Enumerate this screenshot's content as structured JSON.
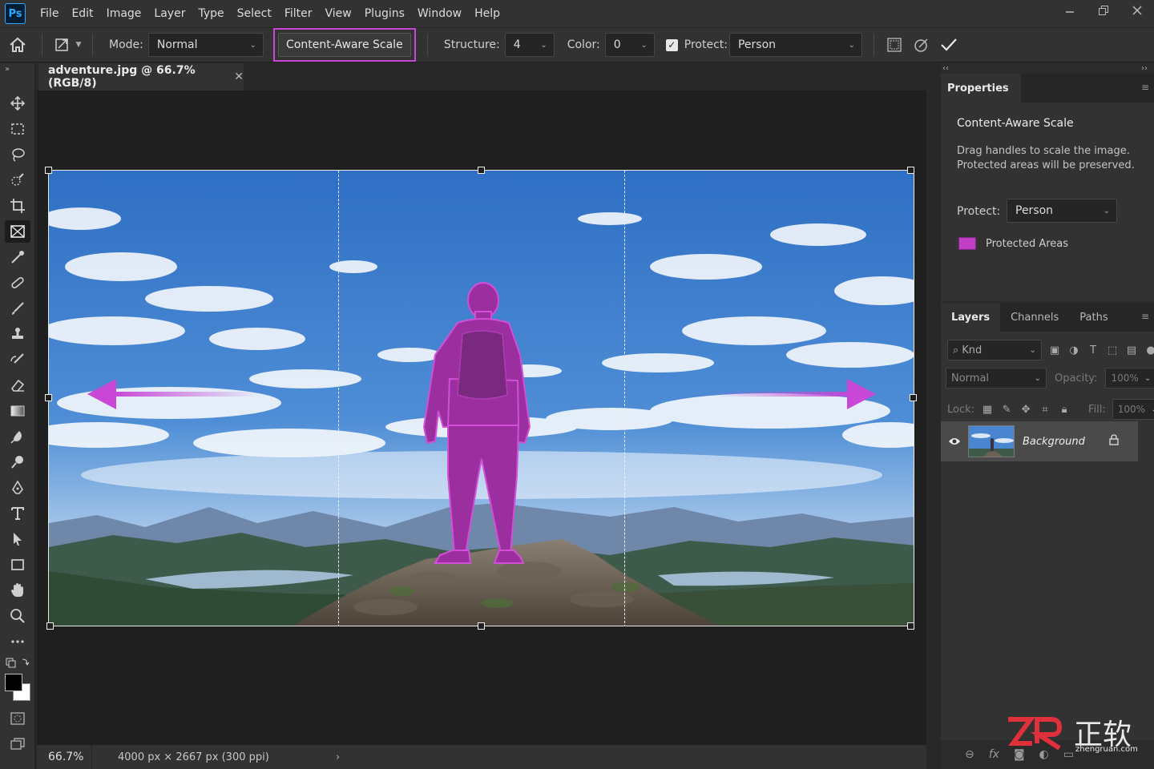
{
  "app": {
    "logo": "Ps",
    "menu": [
      "File",
      "Edit",
      "Image",
      "Layer",
      "Type",
      "Select",
      "Filter",
      "View",
      "Plugins",
      "Window",
      "Help"
    ]
  },
  "options": {
    "mode_label": "Mode:",
    "mode_value": "Normal",
    "cas_button": "Content-Aware Scale",
    "structure_label": "Structure:",
    "structure_value": "4",
    "color_label": "Color:",
    "color_value": "0",
    "protect_label": "Protect:",
    "protect_value": "Person",
    "protect_checked": true
  },
  "toolbar": {
    "tools": [
      "move-icon",
      "marquee-icon",
      "lasso-icon",
      "quick-select-icon",
      "crop-icon",
      "frame-icon",
      "eyedropper-icon",
      "healing-icon",
      "brush-icon",
      "stamp-icon",
      "history-brush-icon",
      "eraser-icon",
      "gradient-icon",
      "blur-icon",
      "dodge-icon",
      "pen-icon",
      "type-icon",
      "path-select-icon",
      "rectangle-icon",
      "hand-icon",
      "zoom-icon",
      "more-icon"
    ],
    "active_tool": "frame-icon",
    "foreground_color": "#000000",
    "background_color": "#ffffff"
  },
  "document": {
    "tab_title": "adventure.jpg @ 66.7% (RGB/8)",
    "zoom": "66.7%",
    "info": "4000 px × 2667 px (300 ppi)"
  },
  "properties": {
    "tab": "Properties",
    "title": "Content-Aware Scale",
    "desc_line1": "Drag handles to scale the image.",
    "desc_line2": "Protected areas will be preserved.",
    "protect_label": "Protect:",
    "protect_value": "Person",
    "swatch_label": "Protected Areas",
    "swatch_color": "#c13fc7"
  },
  "layers": {
    "tabs": [
      "Layers",
      "Channels",
      "Paths"
    ],
    "active_tab": "Layers",
    "kind": "Knd",
    "blend_mode": "Normal",
    "opacity_label": "Opacity:",
    "opacity_value": "100%",
    "lock_label": "Lock:",
    "fill_label": "Fill:",
    "fill_value": "100%",
    "items": [
      {
        "name": "Background",
        "locked": true,
        "visible": true
      }
    ]
  },
  "watermark": {
    "brand": "正软",
    "url": "zhengruan.com"
  },
  "colors": {
    "accent": "#c847d6",
    "protect_overlay": "#b23ab8"
  }
}
